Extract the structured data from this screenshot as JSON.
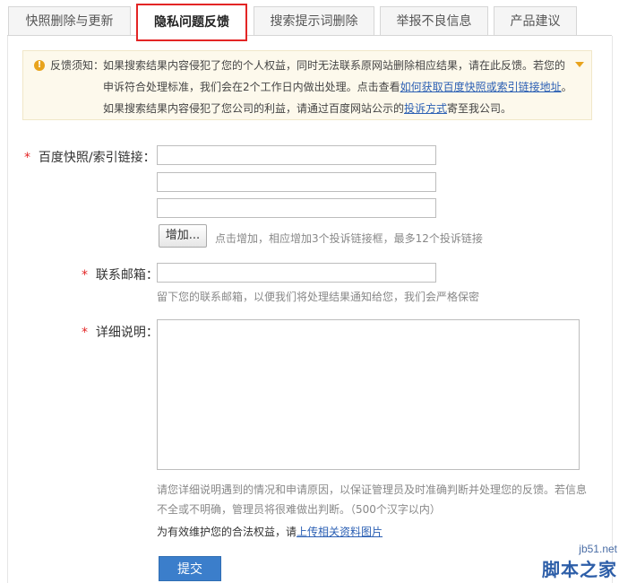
{
  "tabs": [
    {
      "label": "快照删除与更新"
    },
    {
      "label": "隐私问题反馈"
    },
    {
      "label": "搜索提示词删除"
    },
    {
      "label": "举报不良信息"
    },
    {
      "label": "产品建议"
    }
  ],
  "notice": {
    "icon": "exclamation-icon",
    "label": "反馈须知：",
    "line1": "如果搜索结果内容侵犯了您的个人权益，同时无法联系原网站删除相应结果，请在此反馈。若您的",
    "line2_text": "申诉符合处理标准，我们会在2个工作日内做出处理。点击查看",
    "line2_link": "如何获取百度快照或索引链接地址",
    "line2_tail": "。",
    "line3_text": "如果搜索结果内容侵犯了您公司的利益，请通过百度网站公示的",
    "line3_link": "投诉方式",
    "line3_tail": "寄至我公司。"
  },
  "form": {
    "required_mark": "*",
    "link_label": "百度快照/索引链接：",
    "add_button": "增加...",
    "add_hint": "点击增加，相应增加3个投诉链接框，最多12个投诉链接",
    "email_label": "联系邮箱：",
    "email_hint": "留下您的联系邮箱，以便我们将处理结果通知给您，我们会严格保密",
    "detail_label": "详细说明：",
    "detail_hint1": "请您详细说明遇到的情况和申请原因，以保证管理员及时准确判断并处理您的反馈。若信息",
    "detail_hint2": "不全或不明确，管理员将很难做出判断。（500个汉字以内）",
    "protect_text": "为有效维护您的合法权益，请",
    "protect_link": "上传相关资料图片",
    "submit": "提交"
  },
  "watermark": {
    "site": "jb51.net",
    "name": "脚本之家"
  }
}
